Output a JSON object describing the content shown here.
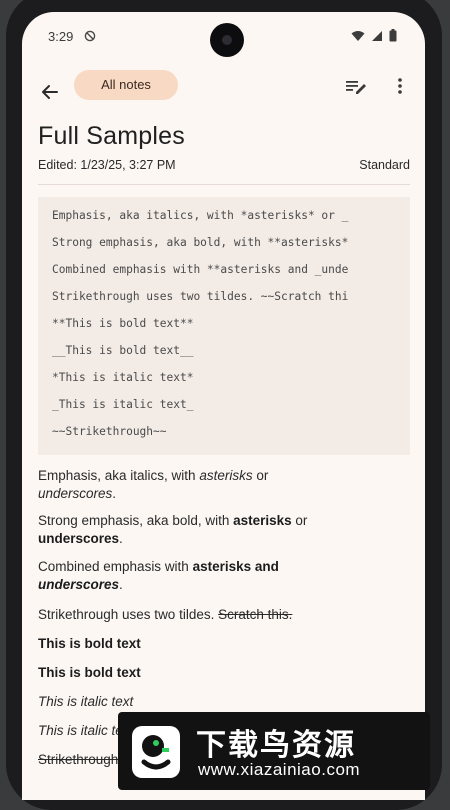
{
  "status": {
    "time": "3:29"
  },
  "header": {
    "chip_label": "All notes"
  },
  "note": {
    "title": "Full Samples",
    "edited": "Edited: 1/23/25, 3:27 PM",
    "mode": "Standard"
  },
  "code_lines": [
    "Emphasis, aka italics, with *asterisks* or _",
    "Strong emphasis, aka bold, with **asterisks*",
    "Combined emphasis with **asterisks and _unde",
    "Strikethrough uses two tildes. ~~Scratch thi",
    "**This is bold text**",
    "__This is bold text__",
    "*This is italic text*",
    "_This is italic text_",
    "~~Strikethrough~~"
  ],
  "rendered": {
    "p1_text": "Emphasis, aka italics, with ",
    "p1_em1": "asterisks",
    "p1_mid": " or ",
    "p1_em2": "underscores",
    "p1_end": ".",
    "p2_text": "Strong emphasis, aka bold, with ",
    "p2_b1": "asterisks",
    "p2_mid": " or ",
    "p2_b2": "underscores",
    "p2_end": ".",
    "p3_text": "Combined emphasis with ",
    "p3_b1": "asterisks and ",
    "p3_bi": "underscores",
    "p3_end": ".",
    "p4_text": "Strikethrough uses two tildes. ",
    "p4_strike": "Scratch this.",
    "bold1": "This is bold text",
    "bold2": "This is bold text",
    "italic1": "This is italic text",
    "italic2": "This is italic text",
    "strike": "Strikethrough"
  },
  "watermark": {
    "name": "下载鸟资源",
    "url": "www.xiazainiao.com"
  },
  "colors": {
    "accent_chip": "#f8d9c3",
    "background": "#fcf7f3",
    "code_bg": "#f2ebe6"
  },
  "icons": [
    "back-arrow-icon",
    "edit-icon",
    "more-vert-icon",
    "wifi-icon",
    "signal-icon",
    "battery-icon",
    "dnd-icon"
  ]
}
